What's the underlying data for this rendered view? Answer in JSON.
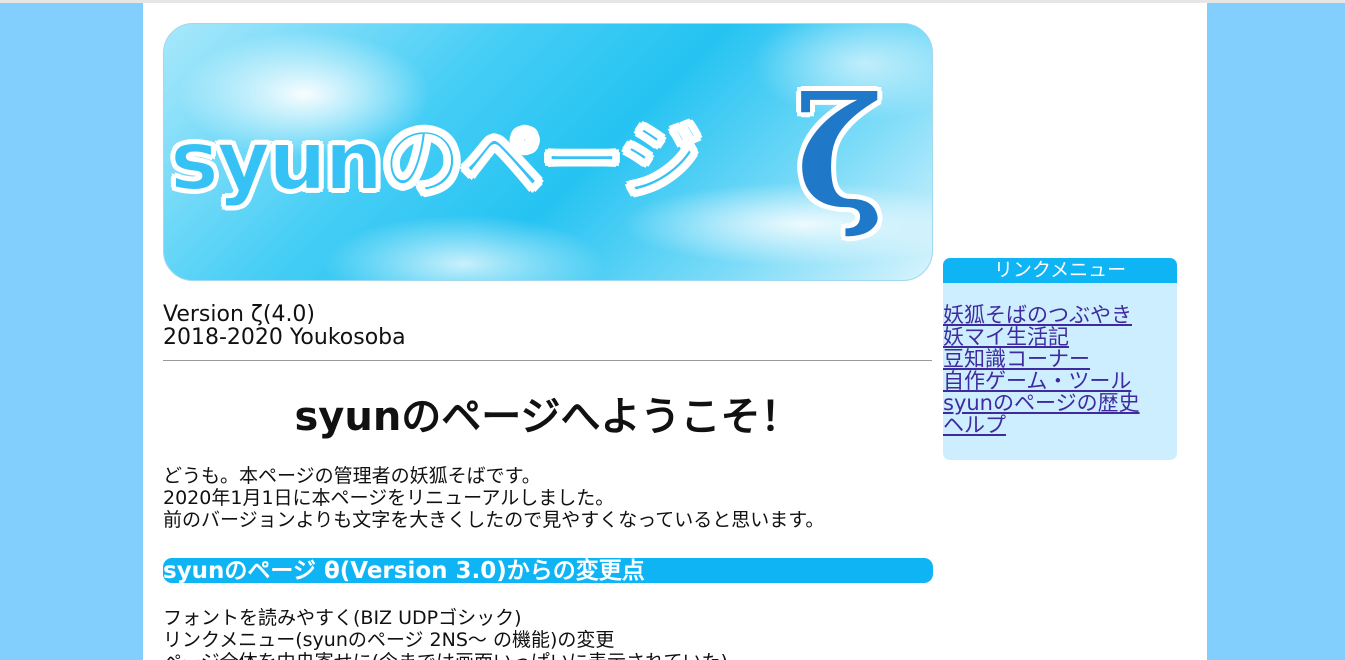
{
  "banner": {
    "title": "syunのページ",
    "version_glyph": "ζ"
  },
  "version": {
    "line1": "Version ζ(4.0)",
    "line2": "2018-2020 Youkosoba"
  },
  "welcome": "syunのページへようこそ！",
  "intro": [
    "どうも。本ページの管理者の妖狐そばです。",
    "2020年1月1日に本ページをリニューアルしました。",
    "前のバージョンよりも文字を大きくしたので見やすくなっていると思います。"
  ],
  "section": {
    "title": "syunのページ θ(Version 3.0)からの変更点"
  },
  "changes": [
    "フォントを読みやすく(BIZ UDPゴシック)",
    "リンクメニュー(syunのページ 2NS～ の機能)の変更",
    "ページ全体を中央寄せに(今までは画面いっぱいに表示されていた)"
  ],
  "linkmenu": {
    "title": "リンクメニュー",
    "items": [
      "妖狐そばのつぶやき",
      "妖マイ生活記",
      "豆知識コーナー",
      "自作ゲーム・ツール",
      "syunのページの歴史",
      "ヘルプ"
    ]
  },
  "colors": {
    "background": "#82cffd",
    "accent": "#0fb4f5",
    "menu_bg": "#cdeeff",
    "link": "#3f2aa0"
  }
}
